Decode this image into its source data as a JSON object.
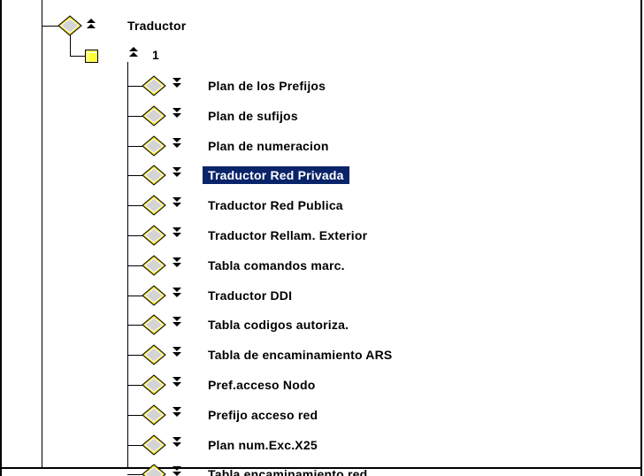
{
  "tree": {
    "root": {
      "label": "Traductor"
    },
    "group": {
      "label": "1"
    },
    "items": [
      {
        "label": "Plan de los Prefijos",
        "selected": false
      },
      {
        "label": "Plan de sufijos",
        "selected": false
      },
      {
        "label": "Plan de numeracion",
        "selected": false
      },
      {
        "label": "Traductor Red Privada",
        "selected": true
      },
      {
        "label": "Traductor Red Publica",
        "selected": false
      },
      {
        "label": "Traductor Rellam.  Exterior",
        "selected": false
      },
      {
        "label": "Tabla comandos marc.",
        "selected": false
      },
      {
        "label": "Traductor DDI",
        "selected": false
      },
      {
        "label": "Tabla codigos autoriza.",
        "selected": false
      },
      {
        "label": "Tabla de encaminamiento ARS",
        "selected": false
      },
      {
        "label": "Pref.acceso Nodo",
        "selected": false
      },
      {
        "label": "Prefijo acceso red",
        "selected": false
      },
      {
        "label": "Plan num.Exc.X25",
        "selected": false
      },
      {
        "label": "Tabla encaminamiento red",
        "selected": false
      }
    ]
  },
  "colors": {
    "diamond_fill": "#d4d4d4",
    "diamond_border": "#e8d800",
    "group_fill": "#ffff33",
    "selection": "#0a246a"
  },
  "icons": {
    "expand": "expand-node-icon",
    "collapse": "collapse-node-icon",
    "object": "diamond-object-icon",
    "folder": "yellow-square-icon"
  }
}
